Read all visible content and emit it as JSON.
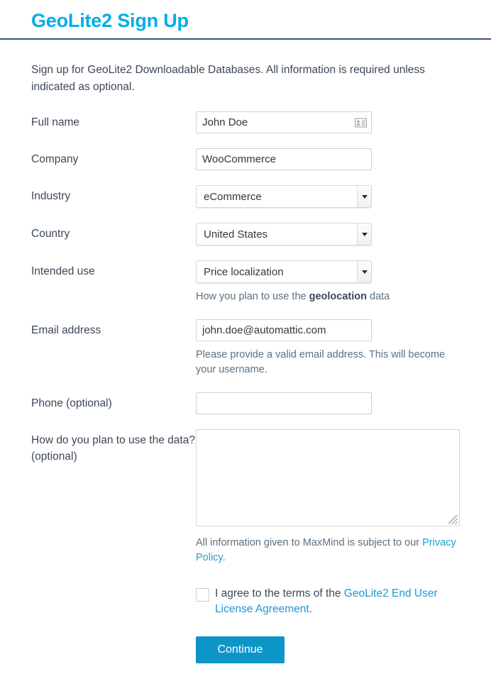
{
  "header": {
    "title": "GeoLite2 Sign Up"
  },
  "intro": {
    "text": "Sign up for GeoLite2 Downloadable Databases. All information is required unless indicated as optional."
  },
  "form": {
    "full_name": {
      "label": "Full name",
      "value": "John Doe",
      "placeholder": "",
      "icon": "contact-card-icon"
    },
    "company": {
      "label": "Company",
      "value": "WooCommerce",
      "placeholder": ""
    },
    "industry": {
      "label": "Industry",
      "value": "eCommerce"
    },
    "country": {
      "label": "Country",
      "value": "United States"
    },
    "intended_use": {
      "label": "Intended use",
      "value": "Price localization",
      "helper_prefix": "How you plan to use the ",
      "helper_bold": "geolocation",
      "helper_suffix": " data"
    },
    "email": {
      "label": "Email address",
      "value": "john.doe@automattic.com",
      "placeholder": "",
      "helper": "Please provide a valid email address. This will become your username."
    },
    "phone": {
      "label": "Phone (optional)",
      "value": "",
      "placeholder": ""
    },
    "plan_to_use": {
      "label": "How do you plan to use the data? (optional)",
      "value": "",
      "placeholder": ""
    }
  },
  "legal": {
    "privacy_prefix": "All information given to MaxMind is subject to our ",
    "privacy_link": "Privacy Policy",
    "privacy_suffix": ".",
    "agree_prefix": "I agree to the terms of the ",
    "agree_link": "GeoLite2 End User License Agreement",
    "agree_suffix": ".",
    "checkbox_checked": "false"
  },
  "actions": {
    "continue_label": "Continue"
  },
  "colors": {
    "title": "#00ade6",
    "rule": "#3c5575",
    "link": "#1a9fd4",
    "button": "#0e95c8",
    "label_text": "#3c4858",
    "helper_text": "#5c7080"
  }
}
